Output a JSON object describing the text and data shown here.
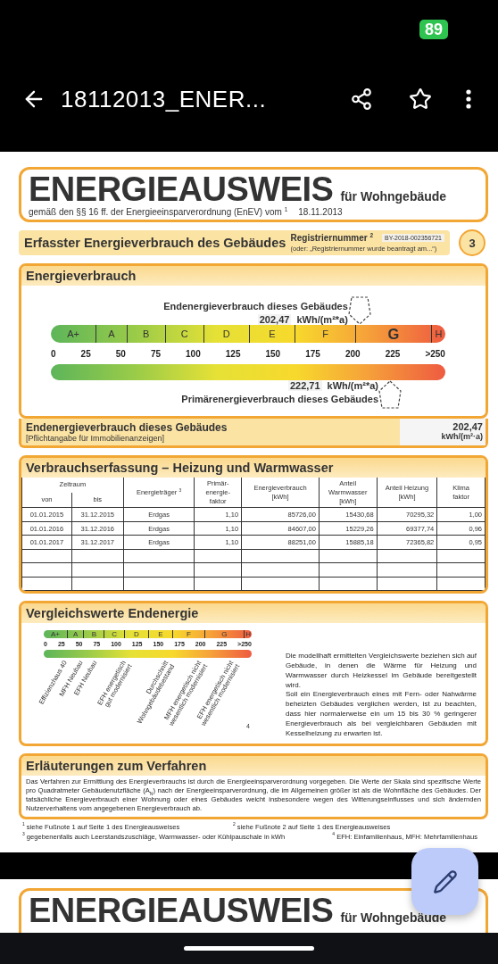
{
  "status_bar": {
    "battery": "89"
  },
  "app_bar": {
    "title": "18112013_ENER..."
  },
  "page": {
    "header": {
      "title": "ENERGIEAUSWEIS",
      "subtitle": "für Wohngebäude",
      "basis": "gemäß den §§ 16 ff. der Energieeinsparverordnung (EnEV) vom $^{1}$",
      "date": "18.11.2013"
    },
    "registry": {
      "heading": "Erfasster Energieverbrauch des Gebäudes",
      "label": "Registriernummer $^{2}$",
      "number": "BY-2018-002356721",
      "note": "(oder: „Registriernummer wurde beantragt am...“)",
      "page_number": "3"
    },
    "energy": {
      "heading": "Energieverbrauch",
      "final": {
        "label": "Endenergieverbrauch dieses Gebäudes",
        "value": "202,47",
        "unit": "kWh/(m²*a)",
        "level": 0.81
      },
      "primary": {
        "label": "Primärenergieverbrauch dieses Gebäudes",
        "value": "222,71",
        "unit": "kWh/(m²*a)",
        "level": 0.89
      },
      "classes": [
        {
          "label": "A+",
          "selected": false
        },
        {
          "label": "A",
          "selected": false
        },
        {
          "label": "B",
          "selected": false
        },
        {
          "label": "C",
          "selected": false
        },
        {
          "label": "D",
          "selected": false
        },
        {
          "label": "E",
          "selected": false
        },
        {
          "label": "F",
          "selected": false
        },
        {
          "label": "G",
          "selected": true
        },
        {
          "label": "H",
          "selected": false
        }
      ],
      "ticks": [
        "0",
        "25",
        "50",
        "75",
        "100",
        "125",
        "150",
        "175",
        "200",
        "225",
        ">250"
      ]
    },
    "summary": {
      "label": "Endenergieverbrauch dieses Gebäudes",
      "note": "[Pflichtangabe für Immobilienanzeigen]",
      "value": "202,47",
      "unit": "kWh/(m²·a)"
    },
    "consumption": {
      "heading": "Verbrauchserfassung – Heizung und Warmwasser",
      "period": "Zeitraum",
      "columns": [
        "von",
        "bis",
        "Energieträger $^{3}$",
        "Primär-\nenergie-\nfaktor",
        "Energieverbrauch\n[kWh]",
        "Anteil\nWarmwasser\n[kWh]",
        "Anteil Heizung\n[kWh]",
        "Klima\nfaktor"
      ],
      "rows": [
        [
          "01.01.2015",
          "31.12.2015",
          "Erdgas",
          "1,10",
          "85726,00",
          "15430,68",
          "70295,32",
          "1,00"
        ],
        [
          "01.01.2016",
          "31.12.2016",
          "Erdgas",
          "1,10",
          "84607,00",
          "15229,26",
          "69377,74",
          "0,96"
        ],
        [
          "01.01.2017",
          "31.12.2017",
          "Erdgas",
          "1,10",
          "88251,00",
          "15885,18",
          "72365,82",
          "0,95"
        ]
      ]
    },
    "comparison": {
      "heading": "Vergleichswerte Endenergie",
      "classes": [
        "A+",
        "A",
        "B",
        "C",
        "D",
        "E",
        "F",
        "G",
        "H"
      ],
      "ticks": [
        "0",
        "25",
        "50",
        "75",
        "100",
        "125",
        "150",
        "175",
        "200",
        "225",
        ">250"
      ],
      "references": [
        "Effizienzhaus 40",
        "MFH Neubau",
        "EFH Neubau",
        "EFH energetisch\ngut modernisiert",
        "Durchschnitt\nWohngebäudebestand",
        "MFH energetisch nicht\nwesentlich modernisiert",
        "EFH energetisch nicht\nwesentlich modernisiert"
      ],
      "footnote": "4",
      "text": [
        "Die modellhaft ermittelten Vergleichswerte beziehen sich auf Gebäude, in denen die Wärme für Heizung und Warmwasser durch Heizkessel im Gebäude bereitgestellt wird.",
        "Soll ein Energieverbrauch eines mit Fern- oder Nahwärme beheizten Gebäudes verglichen werden, ist zu beachten, dass hier normalerweise ein um 15 bis 30 % geringerer Energieverbrauch als bei vergleichbaren Gebäuden mit Kesselheizung zu erwarten ist."
      ]
    },
    "explanation": {
      "heading": "Erläuterungen zum Verfahren",
      "text": "Das Verfahren zur Ermittlung des Energieverbrauchs ist durch die Energieeinsparverordnung vorgegeben. Die Werte der Skala sind spezifische Werte pro Quadratmeter Gebäudenutzfläche (A$_{N}$) nach der Energieeinsparverordnung, die im Allgemeinen größer ist als die Wohnfläche des Gebäudes. Der tatsächliche Energieverbrauch einer Wohnung oder eines Gebäudes weicht insbesondere wegen des Witterungseinflusses und sich ändernden Nutzerverhaltens vom angegebenen Energieverbrauch ab."
    },
    "footnotes": [
      "$^{1}$ siehe Fußnote 1 auf Seite 1 des Energieausweises",
      "$^{2}$ siehe Fußnote 2 auf Seite 1 des Energieausweises",
      "$^{3}$ gegebenenfalls auch Leerstandszuschläge, Warmwasser- oder Kühlpauschale in kWh",
      "$^{4}$ EFH: Einfamilienhaus, MFH: Mehrfamilienhaus"
    ]
  },
  "next_page": {
    "title": "ENERGIEAUSWEIS",
    "subtitle": "für Wohngebäude"
  }
}
